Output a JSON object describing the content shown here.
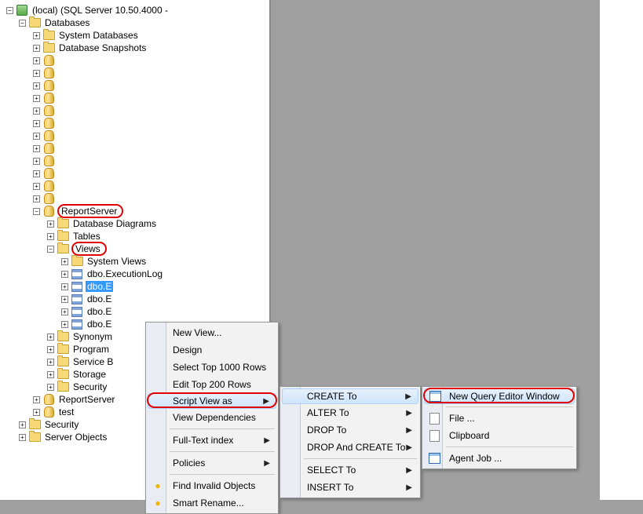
{
  "tree": {
    "server": "(local) (SQL Server 10.50.4000 -",
    "databases": "Databases",
    "sysdb": "System Databases",
    "snapshots": "Database Snapshots",
    "reportserver": "ReportServer",
    "dbdiagrams": "Database Diagrams",
    "tables": "Tables",
    "views": "Views",
    "sysviews": "System Views",
    "v_exec": "dbo.ExecutionLog",
    "v_sel": "dbo.E",
    "v_e2": "dbo.E",
    "v_e3": "dbo.E",
    "v_e4": "dbo.E",
    "synonym": "Synonym",
    "program": "Program",
    "serviceb": "Service B",
    "storage": "Storage",
    "security_sub": "Security",
    "reportservertmp": "ReportServer",
    "test": "test",
    "security": "Security",
    "serverobjects": "Server Objects"
  },
  "menu1": {
    "new_view": "New View...",
    "design": "Design",
    "sel1000": "Select Top 1000 Rows",
    "edit200": "Edit Top 200 Rows",
    "scriptview": "Script View as",
    "viewdeps": "View Dependencies",
    "fulltext": "Full-Text index",
    "policies": "Policies",
    "find_invalid": "Find Invalid Objects",
    "smart_rename": "Smart Rename..."
  },
  "menu2": {
    "create": "CREATE To",
    "alter": "ALTER To",
    "drop": "DROP To",
    "dropcreate": "DROP And CREATE To",
    "select": "SELECT To",
    "insert": "INSERT To"
  },
  "menu3": {
    "newquery": "New Query Editor Window",
    "file": "File ...",
    "clipboard": "Clipboard",
    "agent": "Agent Job ..."
  }
}
